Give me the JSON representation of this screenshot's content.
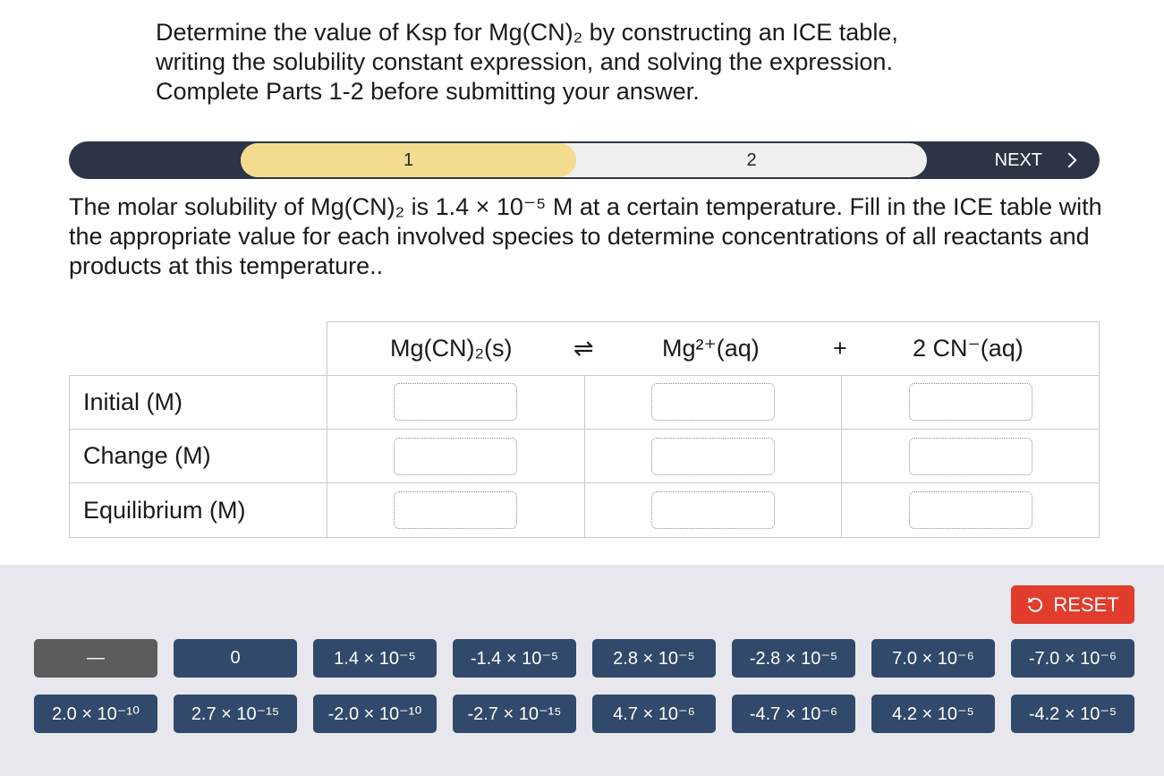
{
  "intro": {
    "line1": "Determine the value of Ksp for Mg(CN)₂ by constructing an ICE table,",
    "line2": "writing the solubility constant expression, and solving the expression.",
    "line3": "Complete Parts 1-2 before submitting your answer."
  },
  "stepper": {
    "step1": "1",
    "step2": "2",
    "next_label": "NEXT"
  },
  "prompt": "The molar solubility of Mg(CN)₂ is 1.4 × 10⁻⁵ M at a certain temperature. Fill in the ICE table with the appropriate value for each involved species to determine concentrations of all reactants and products at this temperature..",
  "ice_table": {
    "species1": "Mg(CN)₂(s)",
    "equilibrium_arrow": "⇌",
    "species2": "Mg²⁺(aq)",
    "plus": "+",
    "species3": "2 CN⁻(aq)",
    "rows": [
      "Initial (M)",
      "Change (M)",
      "Equilibrium (M)"
    ]
  },
  "tray": {
    "reset_label": "RESET",
    "tiles_row1": [
      "—",
      "0",
      "1.4 × 10⁻⁵",
      "-1.4 × 10⁻⁵",
      "2.8 × 10⁻⁵",
      "-2.8 × 10⁻⁵",
      "7.0 × 10⁻⁶",
      "-7.0 × 10⁻⁶"
    ],
    "tiles_row2": [
      "2.0 × 10⁻¹⁰",
      "2.7 × 10⁻¹⁵",
      "-2.0 × 10⁻¹⁰",
      "-2.7 × 10⁻¹⁵",
      "4.7 × 10⁻⁶",
      "-4.7 × 10⁻⁶",
      "4.2 × 10⁻⁵",
      "-4.2 × 10⁻⁵"
    ]
  },
  "colors": {
    "stepper_bg": "#2d3446",
    "active_step": "#f3dc8f",
    "inactive_step": "#efefef",
    "tile": "#31496a",
    "tile_dash": "#5c5c5c",
    "reset": "#e23c2c",
    "tray_bg": "#e7e7ed"
  }
}
